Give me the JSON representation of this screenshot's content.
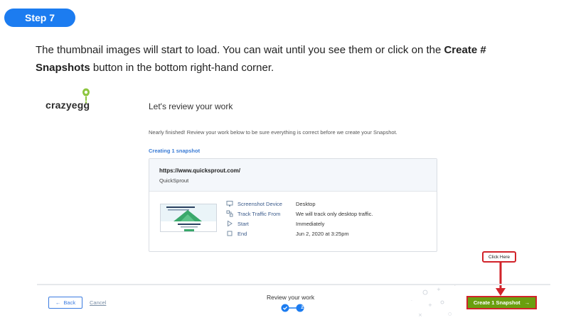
{
  "step_label": "Step 7",
  "instructions": {
    "part1": "The thumbnail images will start to load. You can wait until you see them or click on the ",
    "bold": "Create # Snapshots",
    "part2": " button in the bottom right-hand corner."
  },
  "app": {
    "logo_text": "crazyegg",
    "title": "Let's review your work",
    "subtitle": "Nearly finished! Review your work below to be sure everything is correct before we create your Snapshot.",
    "creating_label": "Creating 1 snapshot",
    "card": {
      "url": "https://www.quicksprout.com/",
      "site_name": "QuickSprout",
      "details": [
        {
          "icon": "monitor-icon",
          "label": "Screenshot Device",
          "value": "Desktop"
        },
        {
          "icon": "traffic-icon",
          "label": "Track Traffic From",
          "value": "We will track only desktop traffic."
        },
        {
          "icon": "play-icon",
          "label": "Start",
          "value": "Immediately"
        },
        {
          "icon": "stop-icon",
          "label": "End",
          "value": "Jun 2, 2020 at 3:25pm"
        }
      ]
    },
    "footer": {
      "back_label": "Back",
      "cancel_label": "Cancel",
      "progress_label": "Review your work",
      "step_number": "2",
      "create_label": "Create 1 Snapshot"
    }
  },
  "annotation": {
    "callout_text": "Click Here",
    "color": "#d1232a"
  },
  "colors": {
    "accent": "#1c7cf0",
    "create_button": "#6a9f0f",
    "link": "#3b7be0"
  }
}
